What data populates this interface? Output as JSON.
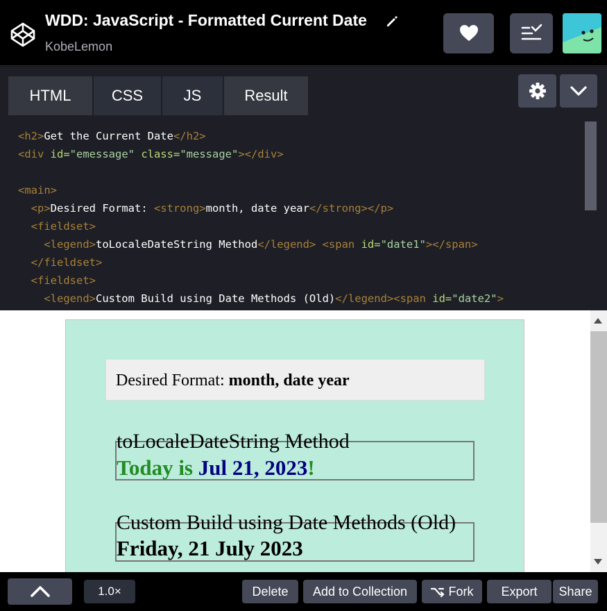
{
  "header": {
    "title": "WDD: JavaScript - Formatted Current Date",
    "author": "KobeLemon"
  },
  "tabs": [
    {
      "label": "HTML"
    },
    {
      "label": "CSS"
    },
    {
      "label": "JS"
    },
    {
      "label": "Result"
    }
  ],
  "code": {
    "l1": {
      "a": "<h2>",
      "b": "Get the Current Date",
      "c": "</h2>"
    },
    "l2": {
      "a": "<div ",
      "b": "id=",
      "c": "\"emessage\" ",
      "d": "class=",
      "e": "\"message\"",
      "f": "></div>"
    },
    "l4": {
      "a": "<main>"
    },
    "l5": {
      "a": "<p>",
      "b": "Desired Format: ",
      "c": "<strong>",
      "d": "month, date year",
      "e": "</strong></p>"
    },
    "l6": {
      "a": "<fieldset>"
    },
    "l7": {
      "a": "<legend>",
      "b": "toLocaleDateString Method",
      "c": "</legend> <span ",
      "d": "id=",
      "e": "\"date1\"",
      "f": "></span>"
    },
    "l8": {
      "a": "</fieldset>"
    },
    "l9": {
      "a": "<fieldset>"
    },
    "l10": {
      "a": "<legend>",
      "b": "Custom Build using Date Methods (Old)",
      "c": "</legend><span ",
      "d": "id=",
      "e": "\"date2\"",
      "f": ">"
    }
  },
  "preview": {
    "desired_label": "Desired Format: ",
    "desired_value": "month, date year",
    "legend1": "toLocaleDateString Method",
    "date1_prefix": "Today is ",
    "date1_value": "Jul 21, 2023",
    "date1_suffix": "!",
    "legend2": "Custom Build using Date Methods (Old)",
    "date2": "Friday, 21 July 2023"
  },
  "footer": {
    "zoom": "1.0×",
    "delete": "Delete",
    "add_to_collection": "Add to Collection",
    "fork": "Fork",
    "export": "Export",
    "share": "Share"
  },
  "icons": {
    "logo": "codepen-logo-icon",
    "edit": "pencil-icon",
    "love": "heart-icon",
    "collection": "list-check-icon",
    "settings": "gear-icon",
    "view": "chevron-down-icon",
    "console": "chevron-up-icon",
    "fork": "fork-icon"
  },
  "colors": {
    "preview_bg": "#bcecdc",
    "today_green": "#228b22",
    "date_navy": "#000080"
  }
}
